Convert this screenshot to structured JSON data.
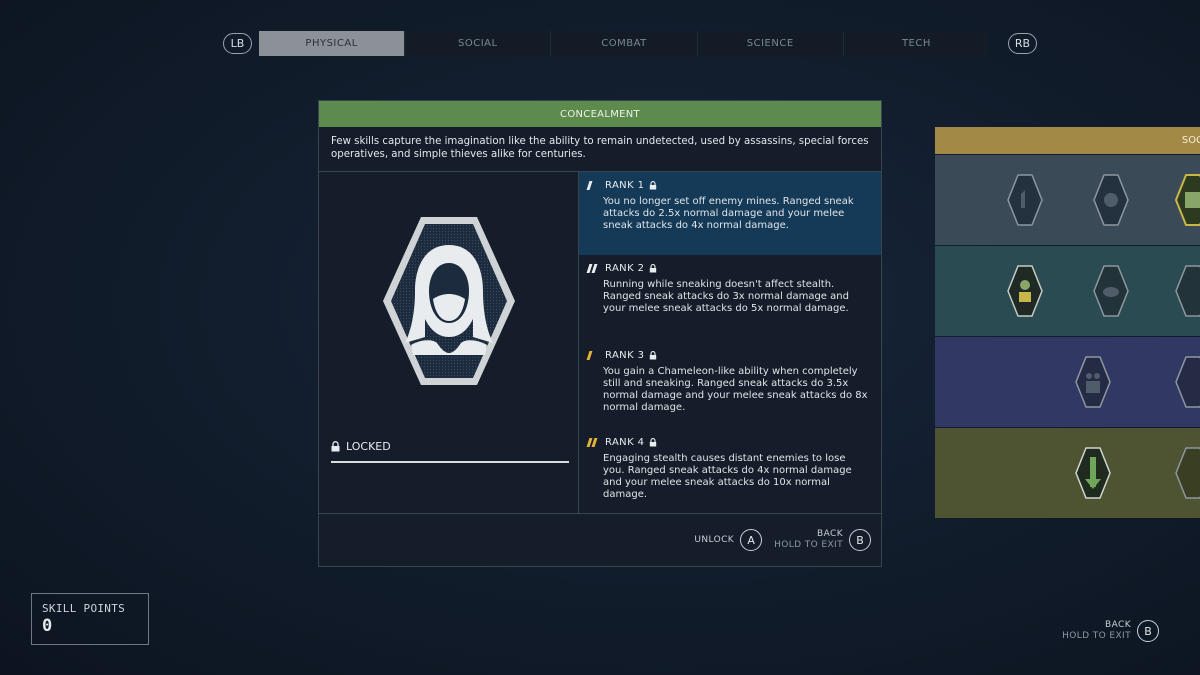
{
  "nav": {
    "left_bumper": "LB",
    "right_bumper": "RB",
    "tabs": [
      {
        "label": "PHYSICAL",
        "active": true
      },
      {
        "label": "SOCIAL",
        "active": false
      },
      {
        "label": "COMBAT",
        "active": false
      },
      {
        "label": "SCIENCE",
        "active": false
      },
      {
        "label": "TECH",
        "active": false
      }
    ]
  },
  "skill": {
    "title": "CONCEALMENT",
    "description": "Few skills capture the imagination like the ability to remain undetected, used by assassins, special forces operatives, and simple thieves alike for centuries.",
    "status": "LOCKED",
    "badge_icon": "hooded-figure-icon",
    "ranks": [
      {
        "label": "RANK 1",
        "text": "You no longer set off enemy mines. Ranged sneak attacks do 2.5x normal damage and your melee sneak attacks do 4x normal damage."
      },
      {
        "label": "RANK 2",
        "text": "Running while sneaking doesn't affect stealth. Ranged sneak attacks do 3x normal damage and your melee sneak attacks do 5x normal damage."
      },
      {
        "label": "RANK 3",
        "text": "You gain a Chameleon-like ability when completely still and sneaking. Ranged sneak attacks do 3.5x normal damage and your melee sneak attacks do 8x normal damage."
      },
      {
        "label": "RANK 4",
        "text": "Engaging stealth causes distant enemies to lose you. Ranged sneak attacks do 4x normal damage and your melee sneak attacks do 10x normal damage."
      }
    ]
  },
  "footer": {
    "unlock_label": "UNLOCK",
    "unlock_button": "A",
    "back_label": "BACK",
    "back_sub": "HOLD TO EXIT",
    "back_button": "B"
  },
  "tree": {
    "header": "SOCI"
  },
  "skill_points": {
    "label": "SKILL POINTS",
    "value": "0"
  },
  "screen_back": {
    "label": "BACK",
    "sub": "HOLD TO EXIT",
    "button": "B"
  },
  "colors": {
    "title_bar": "#5d8a4d",
    "selected_rank": "#153a58",
    "rank_pip_gold": "#e6b339",
    "tree_header": "#a28a46"
  }
}
